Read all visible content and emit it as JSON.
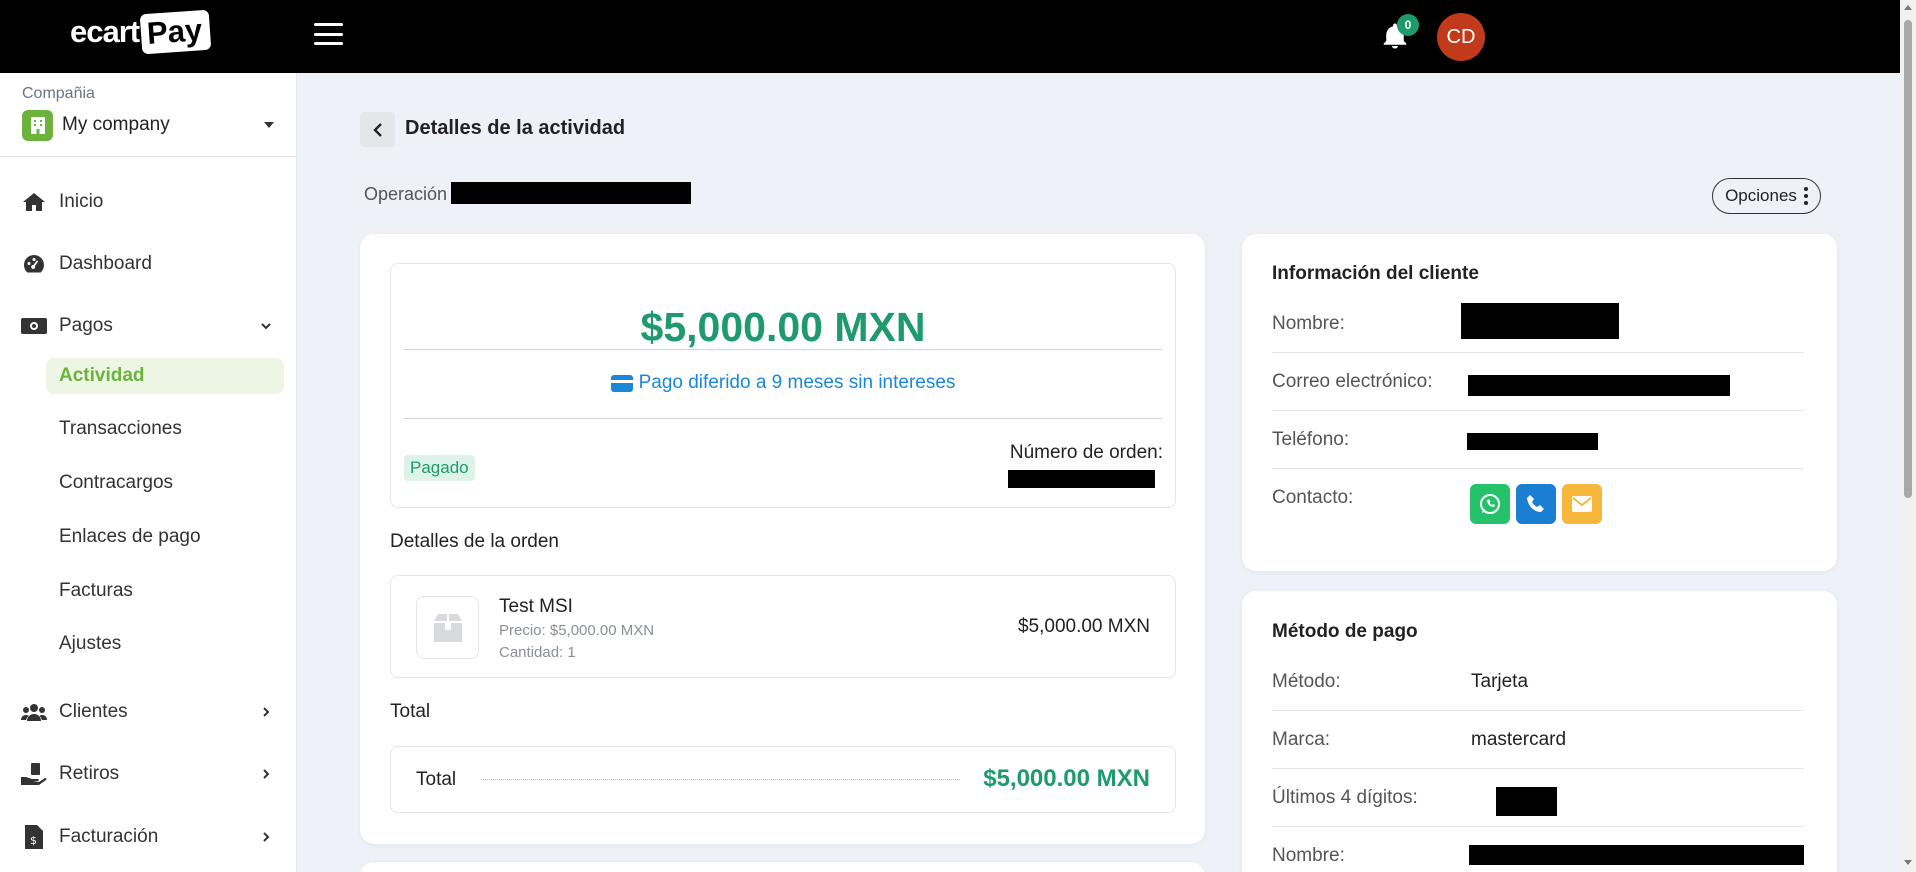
{
  "header": {
    "logo_text": "ecart",
    "logo_pay": "Pay",
    "notification_count": "0",
    "avatar_initials": "CD"
  },
  "sidebar": {
    "company_label": "Compañia",
    "company_name": "My company",
    "items": [
      {
        "label": "Inicio",
        "icon": "home-icon"
      },
      {
        "label": "Dashboard",
        "icon": "gauge-icon"
      },
      {
        "label": "Pagos",
        "icon": "money-icon"
      },
      {
        "label": "Clientes",
        "icon": "users-icon"
      },
      {
        "label": "Retiros",
        "icon": "hand-money-icon"
      },
      {
        "label": "Facturación",
        "icon": "invoice-icon"
      }
    ],
    "pagos_subitems": [
      {
        "label": "Actividad",
        "active": true
      },
      {
        "label": "Transacciones"
      },
      {
        "label": "Contracargos"
      },
      {
        "label": "Enlaces de pago"
      },
      {
        "label": "Facturas"
      },
      {
        "label": "Ajustes"
      }
    ]
  },
  "main": {
    "title": "Detalles de la actividad",
    "operation_label": "Operación",
    "options_label": "Opciones",
    "amount": "$5,000.00 MXN",
    "deferred_text": "Pago diferido a 9 meses sin intereses",
    "status": "Pagado",
    "order_number_label": "Número de orden:",
    "order_details_title": "Detalles de la orden",
    "product": {
      "name": "Test MSI",
      "price_line": "Precio: $5,000.00 MXN",
      "qty_line": "Cantidad: 1",
      "amount": "$5,000.00 MXN"
    },
    "total_section_title": "Total",
    "total_label": "Total",
    "total_value": "$5,000.00 MXN"
  },
  "customer": {
    "title": "Información del cliente",
    "name_label": "Nombre:",
    "email_label": "Correo electrónico:",
    "phone_label": "Teléfono:",
    "contact_label": "Contacto:"
  },
  "payment": {
    "title": "Método de pago",
    "method_label": "Método:",
    "method_value": "Tarjeta",
    "brand_label": "Marca:",
    "brand_value": "mastercard",
    "last4_label": "Últimos 4 dígitos:",
    "name_label": "Nombre:"
  },
  "colors": {
    "accent_green": "#1e9a6d",
    "brand_green": "#6bb33c",
    "link_blue": "#1a88d8",
    "whatsapp": "#25c26b",
    "phone": "#1a7fd1",
    "email": "#f6b73c",
    "avatar": "#c23a1c"
  }
}
